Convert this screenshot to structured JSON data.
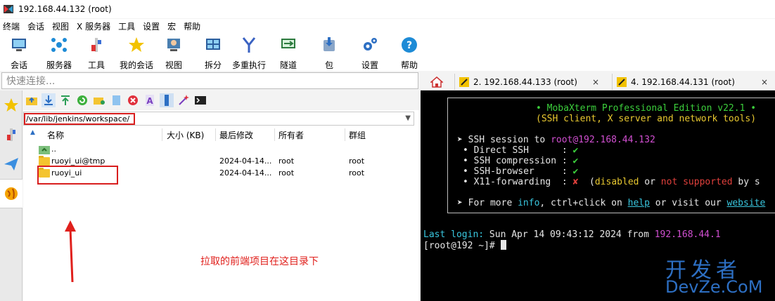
{
  "window": {
    "title": "192.168.44.132 (root)"
  },
  "menu": [
    "终端",
    "会话",
    "视图",
    "X 服务器",
    "工具",
    "设置",
    "宏",
    "帮助"
  ],
  "toolbar": [
    {
      "label": "会话",
      "icon": "session-icon"
    },
    {
      "label": "服务器",
      "icon": "servers-icon"
    },
    {
      "label": "工具",
      "icon": "tools-icon"
    },
    {
      "label": "我的会话",
      "icon": "star-icon"
    },
    {
      "label": "视图",
      "icon": "view-icon"
    },
    {
      "label": "拆分",
      "icon": "split-icon"
    },
    {
      "label": "多重执行",
      "icon": "multiexec-icon"
    },
    {
      "label": "隧道",
      "icon": "tunnel-icon"
    },
    {
      "label": "包",
      "icon": "package-icon"
    },
    {
      "label": "设置",
      "icon": "settings-icon"
    },
    {
      "label": "帮助",
      "icon": "help-icon"
    }
  ],
  "quick_connect": {
    "placeholder": "快速连接..."
  },
  "tabs": [
    {
      "label": "2. 192.168.44.133 (root)"
    },
    {
      "label": "4. 192.168.44.131 (root)"
    }
  ],
  "sftp": {
    "path": "/var/lib/jenkins/workspace/",
    "columns": [
      "名称",
      "大小 (KB)",
      "最后修改",
      "所有者",
      "群组"
    ],
    "parent": "..",
    "rows": [
      {
        "name": "ruoyi_ui@tmp",
        "size": "",
        "modified": "2024-04-14...",
        "owner": "root",
        "group": "root"
      },
      {
        "name": "ruoyi_ui",
        "size": "",
        "modified": "2024-04-14...",
        "owner": "root",
        "group": "root"
      }
    ],
    "annotation": "拉取的前端项目在这目录下"
  },
  "terminal": {
    "banner1": "• MobaXterm Professional Edition v22.1 •",
    "banner2": "(SSH client, X server and network tools)",
    "ssh_prefix": "➤ SSH session to ",
    "ssh_target": "root@192.168.44.132",
    "features": [
      {
        "name": "• Direct SSH      :",
        "mark": "✔"
      },
      {
        "name": "• SSH compression :",
        "mark": "✔"
      },
      {
        "name": "• SSH-browser     :",
        "mark": "✔"
      }
    ],
    "x11_name": "• X11-forwarding  :",
    "x11_mark": "✘",
    "x11_p1": "(",
    "x11_disabled": "disabled",
    "x11_or": " or ",
    "x11_not": "not supported",
    "x11_by": " by s",
    "info_prefix": "➤ For more ",
    "info_word": "info",
    "info_mid": ", ctrl+click on ",
    "help_word": "help",
    "info_mid2": " or visit our ",
    "website_word": "website",
    "last_login_label": "Last login:",
    "last_login_value": " Sun Apr 14 09:43:12 2024 from ",
    "last_login_ip": "192.168.44.1",
    "prompt": "[root@192 ~]# "
  },
  "watermark": {
    "line1": "开发者",
    "line2": "DevZe.CoM"
  },
  "colors": {
    "annotation_red": "#d81e1e",
    "terminal_bg": "#000000",
    "watermark_blue": "#2d6fc3"
  }
}
